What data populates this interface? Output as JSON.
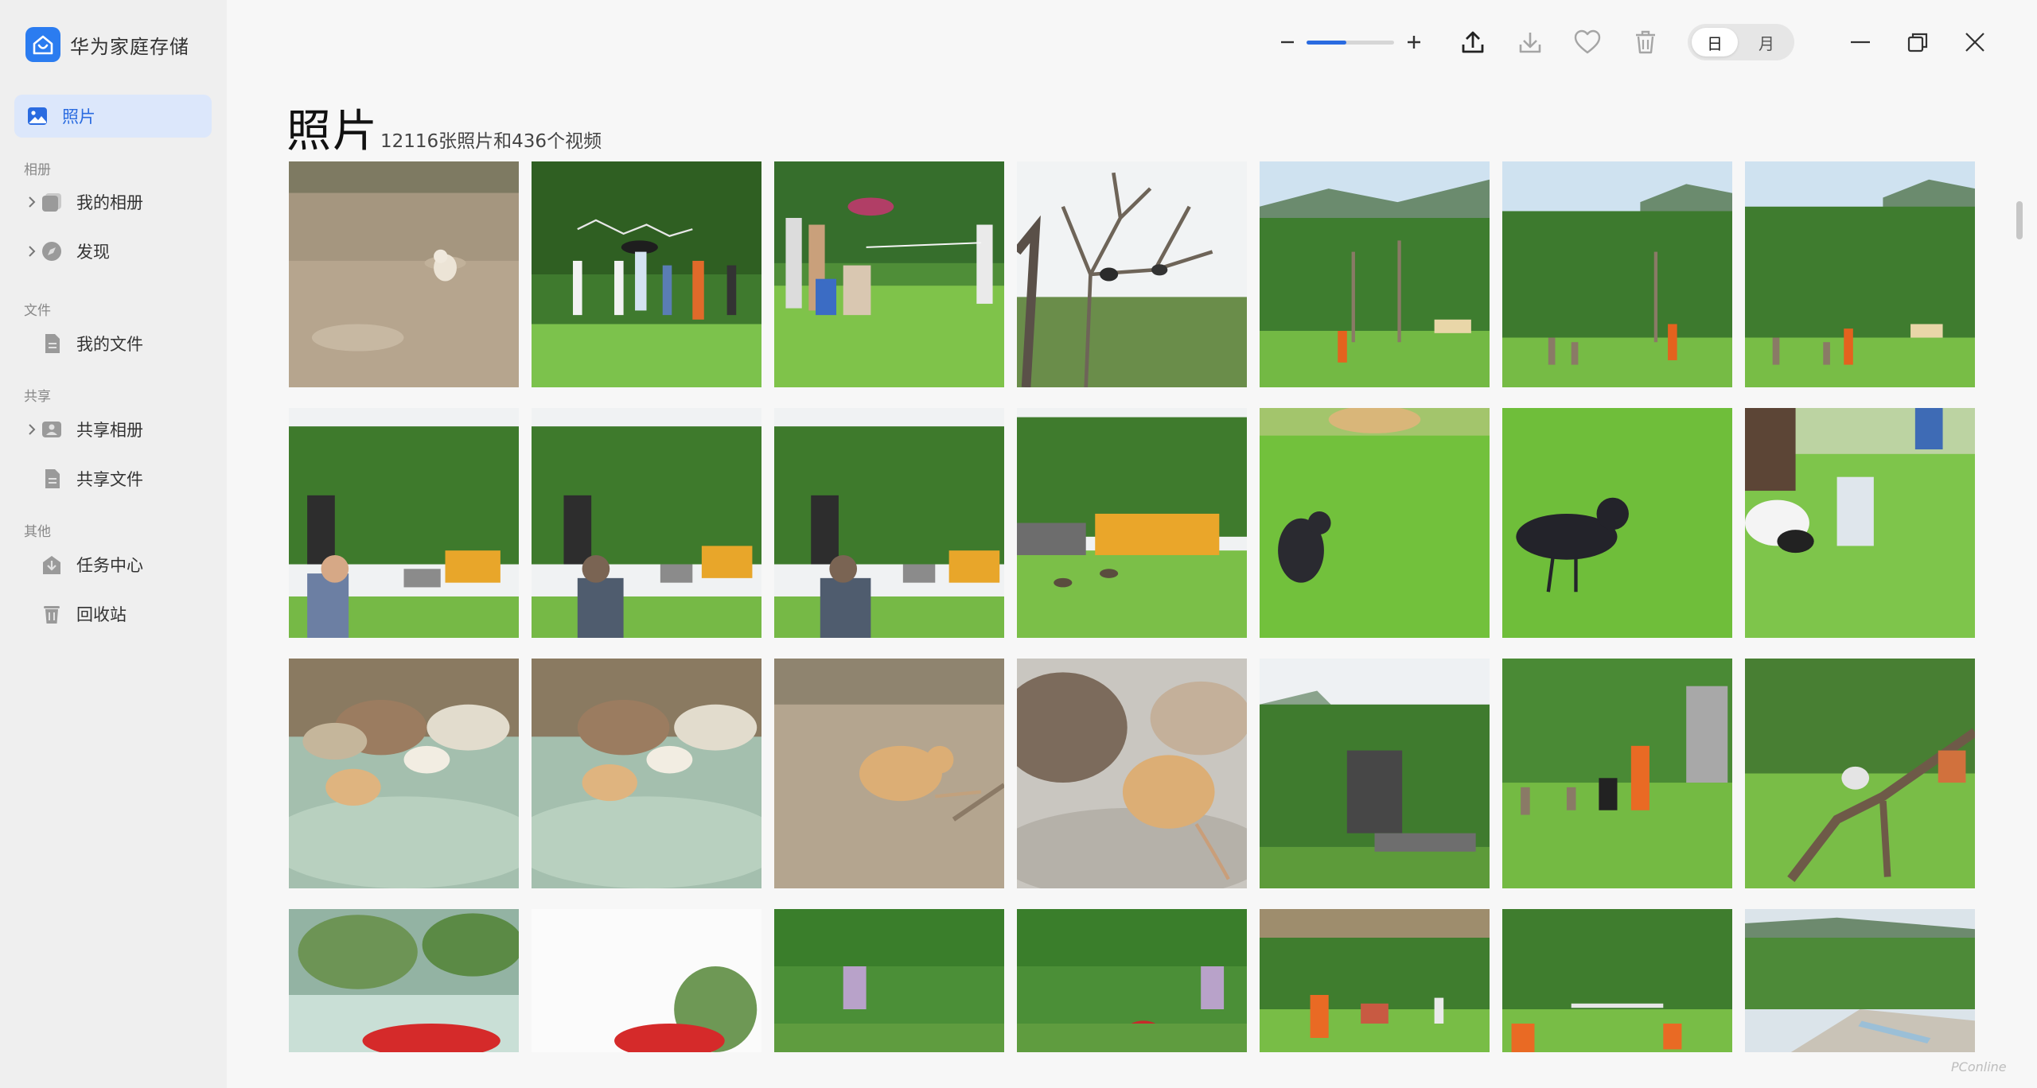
{
  "app": {
    "name": "华为家庭存储"
  },
  "sidebar": {
    "active_item": {
      "label": "照片",
      "icon": "photo-icon"
    },
    "sections": [
      {
        "label": "相册",
        "items": [
          {
            "label": "我的相册",
            "icon": "album-icon",
            "expandable": true
          },
          {
            "label": "发现",
            "icon": "discover-icon",
            "expandable": true
          }
        ]
      },
      {
        "label": "文件",
        "items": [
          {
            "label": "我的文件",
            "icon": "file-icon",
            "expandable": false
          }
        ]
      },
      {
        "label": "共享",
        "items": [
          {
            "label": "共享相册",
            "icon": "shared-album-icon",
            "expandable": true
          },
          {
            "label": "共享文件",
            "icon": "shared-file-icon",
            "expandable": false
          }
        ]
      },
      {
        "label": "其他",
        "items": [
          {
            "label": "任务中心",
            "icon": "task-icon",
            "expandable": false
          },
          {
            "label": "回收站",
            "icon": "trash-icon",
            "expandable": false
          }
        ]
      }
    ]
  },
  "toolbar": {
    "zoom_level": 0.45,
    "view_toggle": {
      "options": [
        "日",
        "月"
      ],
      "selected": "日"
    },
    "actions": [
      "upload-icon",
      "download-icon",
      "favorite-icon",
      "delete-icon"
    ]
  },
  "window_controls": [
    "minimize-icon",
    "restore-icon",
    "close-icon"
  ],
  "main": {
    "title": "照片",
    "summary": "12116张照片和436个视频"
  },
  "photos": [
    {
      "subject": "hamster on dirt ground"
    },
    {
      "subject": "visitors with umbrellas on lawn"
    },
    {
      "subject": "visitors watching show on lawn"
    },
    {
      "subject": "bird on bare branches"
    },
    {
      "subject": "trainer in orange on lawn with palms"
    },
    {
      "subject": "trainer in orange on lawn with palms"
    },
    {
      "subject": "trainer in orange on lawn with palms"
    },
    {
      "subject": "man with backpack near yellow container"
    },
    {
      "subject": "man with backpack near yellow container"
    },
    {
      "subject": "man with backpack near yellow container"
    },
    {
      "subject": "birds flying near yellow container"
    },
    {
      "subject": "crow on grass"
    },
    {
      "subject": "crow on grass"
    },
    {
      "subject": "person feeding crow on grass"
    },
    {
      "subject": "rodent on rocks"
    },
    {
      "subject": "rodent on rocks"
    },
    {
      "subject": "rodent on sandy ground"
    },
    {
      "subject": "rodent on rock close-up"
    },
    {
      "subject": "aviary tower among trees"
    },
    {
      "subject": "trainer with dog on lawn"
    },
    {
      "subject": "bird on tree branch over lawn"
    },
    {
      "subject": "red macaw under palm"
    },
    {
      "subject": "red macaw against bright sky"
    },
    {
      "subject": "parrot in green forest"
    },
    {
      "subject": "parrot in green forest"
    },
    {
      "subject": "people on lawn under trees"
    },
    {
      "subject": "people on lawn under trees"
    },
    {
      "subject": "stream among green hills"
    }
  ],
  "watermark": "PConline"
}
